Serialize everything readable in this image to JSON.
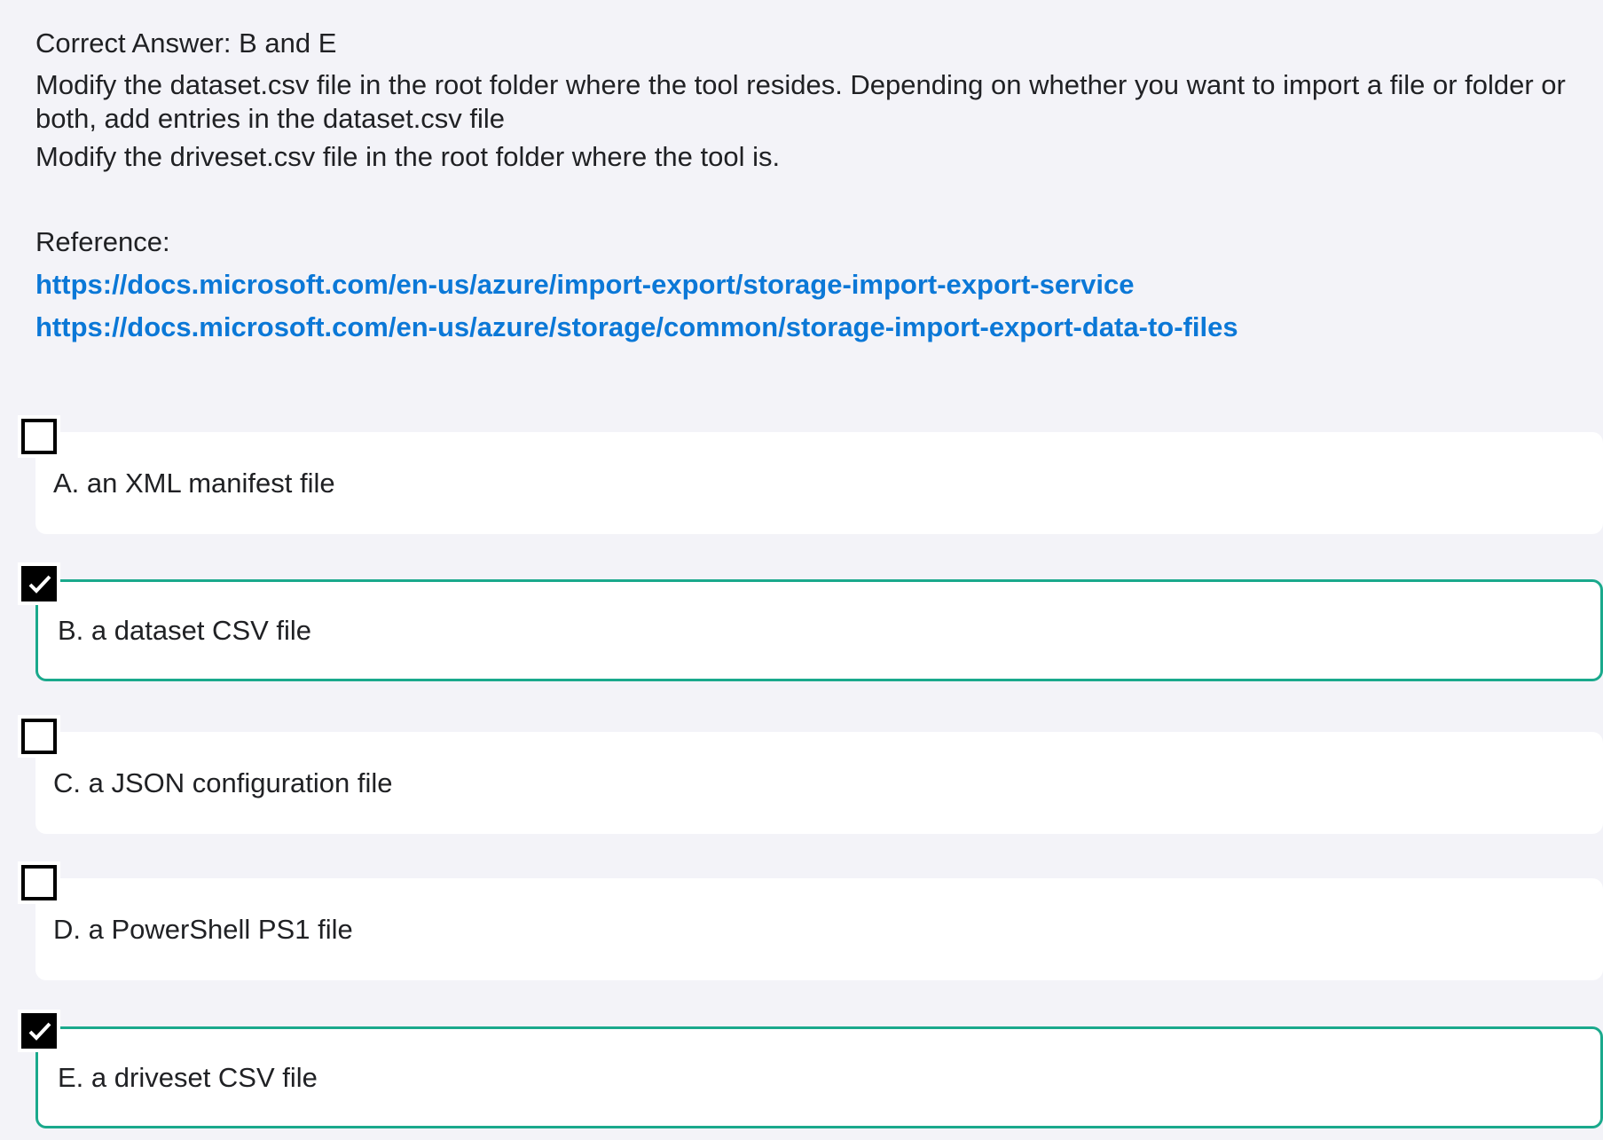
{
  "explanation": {
    "correct_answer": "Correct Answer: B and E",
    "paragraph1": "Modify the dataset.csv file in the root folder where the tool resides. Depending on whether you want to import a file or folder or both, add entries in the dataset.csv file",
    "paragraph2": "Modify the driveset.csv file in the root folder where the tool is.",
    "reference_label": "Reference:",
    "links": [
      "https://docs.microsoft.com/en-us/azure/import-export/storage-import-export-service",
      "https://docs.microsoft.com/en-us/azure/storage/common/storage-import-export-data-to-files"
    ]
  },
  "options": [
    {
      "label": "A. an XML manifest file",
      "checked": false
    },
    {
      "label": "B. a dataset CSV file",
      "checked": true
    },
    {
      "label": "C. a JSON configuration file",
      "checked": false
    },
    {
      "label": "D. a PowerShell PS1 file",
      "checked": false
    },
    {
      "label": "E. a driveset CSV file",
      "checked": true
    }
  ],
  "colors": {
    "background": "#f3f3f8",
    "link": "#0b78d7",
    "selected_border": "#1aa98c",
    "card": "#ffffff"
  }
}
